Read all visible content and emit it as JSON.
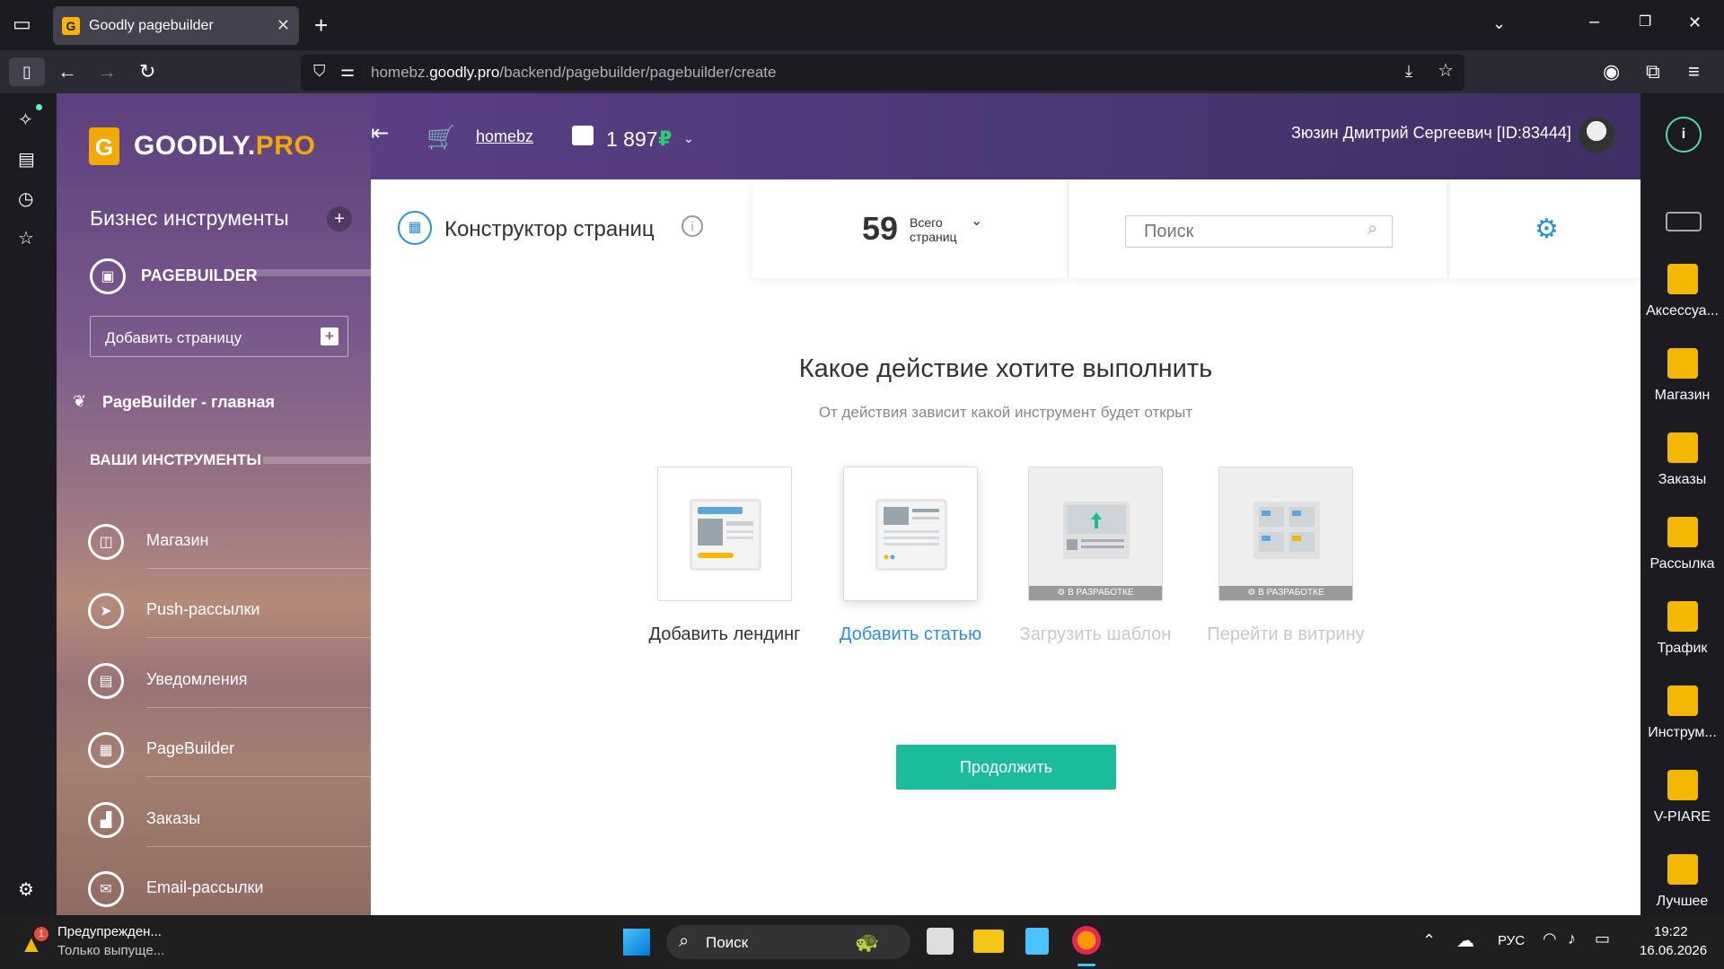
{
  "browser": {
    "tab_title": "Goodly pagebuilder",
    "url_host_prefix": "homebz.",
    "url_host_main": "goodly.pro",
    "url_path": "/backend/pagebuilder/pagebuilder/create"
  },
  "sidebar": {
    "logo_text_main": "GOODLY.",
    "logo_text_accent": "PRO",
    "section_title": "Бизнес инструменты",
    "current_tool": "PAGEBUILDER",
    "add_page_label": "Добавить страницу",
    "home_link": "PageBuilder - главная",
    "tools_heading": "ВАШИ ИНСТРУМЕНТЫ",
    "items": [
      {
        "label": "Магазин"
      },
      {
        "label": "Push-рассылки"
      },
      {
        "label": "Уведомления"
      },
      {
        "label": "PageBuilder"
      },
      {
        "label": "Заказы"
      },
      {
        "label": "Email-рассылки"
      }
    ]
  },
  "header": {
    "shop_link": "homebz",
    "balance": "1 897",
    "currency": "₽",
    "user_name": "Зюзин Дмитрий Сергеевич [ID:83444]"
  },
  "toolbar": {
    "page_title": "Конструктор страниц",
    "pages_count": "59",
    "pages_caption_1": "Всего",
    "pages_caption_2": "страниц",
    "search_placeholder": "Поиск"
  },
  "main": {
    "heading": "Какое действие хотите выполнить",
    "subheading": "От действия зависит какой инструмент будет открыт",
    "options": [
      {
        "label": "Добавить лендинг",
        "state": "normal"
      },
      {
        "label": "Добавить статью",
        "state": "selected"
      },
      {
        "label": "Загрузить шаблон",
        "state": "disabled",
        "badge": "В РАЗРАБОТКЕ"
      },
      {
        "label": "Перейти в витрину",
        "state": "disabled",
        "badge": "В РАЗРАБОТКЕ"
      }
    ],
    "continue_label": "Продолжить"
  },
  "right_panel": {
    "items": [
      {
        "label": "Аксессуа..."
      },
      {
        "label": "Магазин"
      },
      {
        "label": "Заказы"
      },
      {
        "label": "Рассылка"
      },
      {
        "label": "Трафик"
      },
      {
        "label": "Инструм..."
      },
      {
        "label": "V-PIARE"
      },
      {
        "label": "Лучшее"
      }
    ]
  },
  "taskbar": {
    "notif_title": "Предупрежден...",
    "notif_sub": "Только выпуще...",
    "notif_count": "1",
    "search_label": "Поиск",
    "lang": "РУС",
    "time": "19:22",
    "date": "16.06.2026"
  },
  "colors": {
    "accent_teal": "#1abc9c",
    "link_blue": "#2d8fd5",
    "brand_orange": "#f2a900"
  }
}
